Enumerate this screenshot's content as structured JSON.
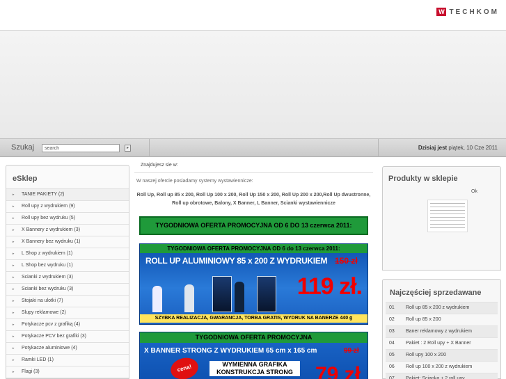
{
  "header": {
    "logo_mark": "W",
    "logo_text": "TECHKOM"
  },
  "searchbar": {
    "label": "Szukaj",
    "input_value": "search",
    "go_glyph": "▸",
    "date_prefix": "Dzisiaj jest",
    "date": "piątek, 10 Cze 2011"
  },
  "left": {
    "title": "eSklep",
    "categories": [
      "TANIE PAKIETY (2)",
      "Roll upy z wydrukiem (9)",
      "Roll upy bez wydruku (5)",
      "X Bannery z wydrukiem (3)",
      "X Bannery bez wydruku (1)",
      "L Shop z wydrukiem (1)",
      "L Shop bez wydruku (1)",
      "Scianki z wydrukiem (3)",
      "Scianki bez wydruku (3)",
      "Stojaki na ulotki (7)",
      "Slupy reklamowe (2)",
      "Potykacze pcv z grafiką (4)",
      "Potykacze PCV bez grafiki (3)",
      "Potykacze aluminiowe (4)",
      "Ramki LED (1)",
      "Flagi (3)"
    ]
  },
  "center": {
    "breadcrumb": "Znajdujesz sie w:",
    "intro": "W naszej ofercie posiadamy systemy wystawiennicze:",
    "products_line": "Roll Up, Roll up 85 x 200, Roll Up 100 x 200, Roll Up 150 x 200, Roll Up 200 x 200,Roll Up dwustronne, Roll up obrotowe, Balony, X Banner, L Banner, Scianki wystawiennicze",
    "promo_heading": "TYGODNIOWA OFERTA PROMOCYJNA OD 6 DO 13 czerwca 2011:",
    "promo1": {
      "title": "TYGODNIOWA OFERTA PROMOCYJNA OD 6 do 13 czerwca 2011:",
      "product": "ROLL UP ALUMINIOWY 85 x 200 Z WYDRUKIEM",
      "old_price": "150 zł",
      "price": "119 zł.",
      "tagline": "SZYBKA REALIZACJA, GWARANCJA, TORBA GRATIS, WYDRUK NA BANERZE 440 g"
    },
    "promo2": {
      "title": "TYGODNIOWA OFERTA PROMOCYJNA",
      "product": "X BANNER STRONG Z WYDRUKIEM 65 cm x 165 cm",
      "old_price": "99 zł",
      "tag": "cena!",
      "line1": "WYMIENNA GRAFIKA KONSTRUKCJA STRONG",
      "price": "79 zł"
    }
  },
  "right": {
    "shop_title": "Produkty w sklepie",
    "shop_ok": "Ok",
    "best_title": "Najczęściej sprzedawane",
    "best": [
      {
        "num": "01",
        "name": "Roll up 85 x 200 z wydrukiem"
      },
      {
        "num": "02",
        "name": "Roll up 85 x 200"
      },
      {
        "num": "03",
        "name": "Baner reklamowy z wydrukiem"
      },
      {
        "num": "04",
        "name": "Pakiet : 2 Roll upy + X Banner"
      },
      {
        "num": "05",
        "name": "Roll upy 100 x 200"
      },
      {
        "num": "06",
        "name": "Roll up 100 x 200 z wydrukiem"
      },
      {
        "num": "07",
        "name": "Pakiet: Scianka + 2 roll upy"
      }
    ]
  }
}
